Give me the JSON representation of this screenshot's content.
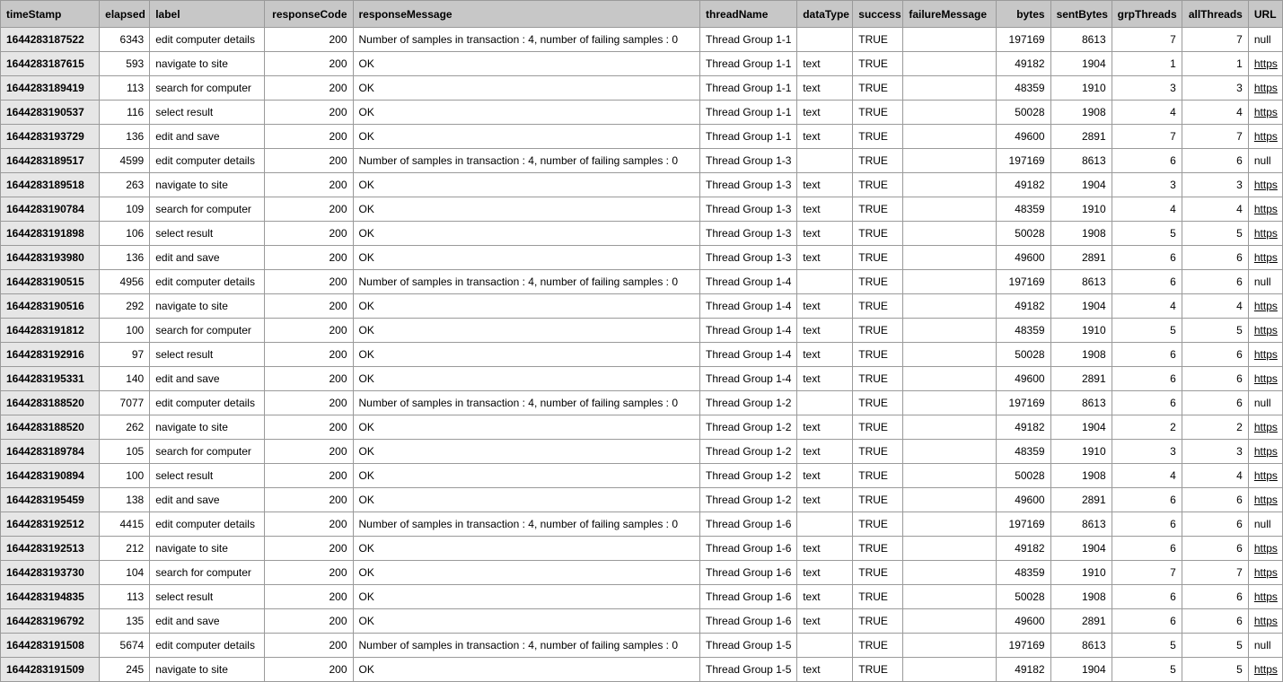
{
  "headers": [
    "timeStamp",
    "elapsed",
    "label",
    "responseCode",
    "responseMessage",
    "threadName",
    "dataType",
    "success",
    "failureMessage",
    "bytes",
    "sentBytes",
    "grpThreads",
    "allThreads",
    "URL"
  ],
  "rows": [
    {
      "timeStamp": "1644283187522",
      "elapsed": "6343",
      "label": "edit computer details",
      "responseCode": "200",
      "responseMessage": "Number of samples in transaction : 4, number of failing samples : 0",
      "threadName": "Thread Group 1-1",
      "dataType": "",
      "success": "TRUE",
      "failureMessage": "",
      "bytes": "197169",
      "sentBytes": "8613",
      "grpThreads": "7",
      "allThreads": "7",
      "URL": "null"
    },
    {
      "timeStamp": "1644283187615",
      "elapsed": "593",
      "label": "navigate to site",
      "responseCode": "200",
      "responseMessage": "OK",
      "threadName": "Thread Group 1-1",
      "dataType": "text",
      "success": "TRUE",
      "failureMessage": "",
      "bytes": "49182",
      "sentBytes": "1904",
      "grpThreads": "1",
      "allThreads": "1",
      "URL": "https"
    },
    {
      "timeStamp": "1644283189419",
      "elapsed": "113",
      "label": "search for computer",
      "responseCode": "200",
      "responseMessage": "OK",
      "threadName": "Thread Group 1-1",
      "dataType": "text",
      "success": "TRUE",
      "failureMessage": "",
      "bytes": "48359",
      "sentBytes": "1910",
      "grpThreads": "3",
      "allThreads": "3",
      "URL": "https"
    },
    {
      "timeStamp": "1644283190537",
      "elapsed": "116",
      "label": "select result",
      "responseCode": "200",
      "responseMessage": "OK",
      "threadName": "Thread Group 1-1",
      "dataType": "text",
      "success": "TRUE",
      "failureMessage": "",
      "bytes": "50028",
      "sentBytes": "1908",
      "grpThreads": "4",
      "allThreads": "4",
      "URL": "https"
    },
    {
      "timeStamp": "1644283193729",
      "elapsed": "136",
      "label": "edit and save",
      "responseCode": "200",
      "responseMessage": "OK",
      "threadName": "Thread Group 1-1",
      "dataType": "text",
      "success": "TRUE",
      "failureMessage": "",
      "bytes": "49600",
      "sentBytes": "2891",
      "grpThreads": "7",
      "allThreads": "7",
      "URL": "https"
    },
    {
      "timeStamp": "1644283189517",
      "elapsed": "4599",
      "label": "edit computer details",
      "responseCode": "200",
      "responseMessage": "Number of samples in transaction : 4, number of failing samples : 0",
      "threadName": "Thread Group 1-3",
      "dataType": "",
      "success": "TRUE",
      "failureMessage": "",
      "bytes": "197169",
      "sentBytes": "8613",
      "grpThreads": "6",
      "allThreads": "6",
      "URL": "null"
    },
    {
      "timeStamp": "1644283189518",
      "elapsed": "263",
      "label": "navigate to site",
      "responseCode": "200",
      "responseMessage": "OK",
      "threadName": "Thread Group 1-3",
      "dataType": "text",
      "success": "TRUE",
      "failureMessage": "",
      "bytes": "49182",
      "sentBytes": "1904",
      "grpThreads": "3",
      "allThreads": "3",
      "URL": "https"
    },
    {
      "timeStamp": "1644283190784",
      "elapsed": "109",
      "label": "search for computer",
      "responseCode": "200",
      "responseMessage": "OK",
      "threadName": "Thread Group 1-3",
      "dataType": "text",
      "success": "TRUE",
      "failureMessage": "",
      "bytes": "48359",
      "sentBytes": "1910",
      "grpThreads": "4",
      "allThreads": "4",
      "URL": "https"
    },
    {
      "timeStamp": "1644283191898",
      "elapsed": "106",
      "label": "select result",
      "responseCode": "200",
      "responseMessage": "OK",
      "threadName": "Thread Group 1-3",
      "dataType": "text",
      "success": "TRUE",
      "failureMessage": "",
      "bytes": "50028",
      "sentBytes": "1908",
      "grpThreads": "5",
      "allThreads": "5",
      "URL": "https"
    },
    {
      "timeStamp": "1644283193980",
      "elapsed": "136",
      "label": "edit and save",
      "responseCode": "200",
      "responseMessage": "OK",
      "threadName": "Thread Group 1-3",
      "dataType": "text",
      "success": "TRUE",
      "failureMessage": "",
      "bytes": "49600",
      "sentBytes": "2891",
      "grpThreads": "6",
      "allThreads": "6",
      "URL": "https"
    },
    {
      "timeStamp": "1644283190515",
      "elapsed": "4956",
      "label": "edit computer details",
      "responseCode": "200",
      "responseMessage": "Number of samples in transaction : 4, number of failing samples : 0",
      "threadName": "Thread Group 1-4",
      "dataType": "",
      "success": "TRUE",
      "failureMessage": "",
      "bytes": "197169",
      "sentBytes": "8613",
      "grpThreads": "6",
      "allThreads": "6",
      "URL": "null"
    },
    {
      "timeStamp": "1644283190516",
      "elapsed": "292",
      "label": "navigate to site",
      "responseCode": "200",
      "responseMessage": "OK",
      "threadName": "Thread Group 1-4",
      "dataType": "text",
      "success": "TRUE",
      "failureMessage": "",
      "bytes": "49182",
      "sentBytes": "1904",
      "grpThreads": "4",
      "allThreads": "4",
      "URL": "https"
    },
    {
      "timeStamp": "1644283191812",
      "elapsed": "100",
      "label": "search for computer",
      "responseCode": "200",
      "responseMessage": "OK",
      "threadName": "Thread Group 1-4",
      "dataType": "text",
      "success": "TRUE",
      "failureMessage": "",
      "bytes": "48359",
      "sentBytes": "1910",
      "grpThreads": "5",
      "allThreads": "5",
      "URL": "https"
    },
    {
      "timeStamp": "1644283192916",
      "elapsed": "97",
      "label": "select result",
      "responseCode": "200",
      "responseMessage": "OK",
      "threadName": "Thread Group 1-4",
      "dataType": "text",
      "success": "TRUE",
      "failureMessage": "",
      "bytes": "50028",
      "sentBytes": "1908",
      "grpThreads": "6",
      "allThreads": "6",
      "URL": "https"
    },
    {
      "timeStamp": "1644283195331",
      "elapsed": "140",
      "label": "edit and save",
      "responseCode": "200",
      "responseMessage": "OK",
      "threadName": "Thread Group 1-4",
      "dataType": "text",
      "success": "TRUE",
      "failureMessage": "",
      "bytes": "49600",
      "sentBytes": "2891",
      "grpThreads": "6",
      "allThreads": "6",
      "URL": "https"
    },
    {
      "timeStamp": "1644283188520",
      "elapsed": "7077",
      "label": "edit computer details",
      "responseCode": "200",
      "responseMessage": "Number of samples in transaction : 4, number of failing samples : 0",
      "threadName": "Thread Group 1-2",
      "dataType": "",
      "success": "TRUE",
      "failureMessage": "",
      "bytes": "197169",
      "sentBytes": "8613",
      "grpThreads": "6",
      "allThreads": "6",
      "URL": "null"
    },
    {
      "timeStamp": "1644283188520",
      "elapsed": "262",
      "label": "navigate to site",
      "responseCode": "200",
      "responseMessage": "OK",
      "threadName": "Thread Group 1-2",
      "dataType": "text",
      "success": "TRUE",
      "failureMessage": "",
      "bytes": "49182",
      "sentBytes": "1904",
      "grpThreads": "2",
      "allThreads": "2",
      "URL": "https"
    },
    {
      "timeStamp": "1644283189784",
      "elapsed": "105",
      "label": "search for computer",
      "responseCode": "200",
      "responseMessage": "OK",
      "threadName": "Thread Group 1-2",
      "dataType": "text",
      "success": "TRUE",
      "failureMessage": "",
      "bytes": "48359",
      "sentBytes": "1910",
      "grpThreads": "3",
      "allThreads": "3",
      "URL": "https"
    },
    {
      "timeStamp": "1644283190894",
      "elapsed": "100",
      "label": "select result",
      "responseCode": "200",
      "responseMessage": "OK",
      "threadName": "Thread Group 1-2",
      "dataType": "text",
      "success": "TRUE",
      "failureMessage": "",
      "bytes": "50028",
      "sentBytes": "1908",
      "grpThreads": "4",
      "allThreads": "4",
      "URL": "https"
    },
    {
      "timeStamp": "1644283195459",
      "elapsed": "138",
      "label": "edit and save",
      "responseCode": "200",
      "responseMessage": "OK",
      "threadName": "Thread Group 1-2",
      "dataType": "text",
      "success": "TRUE",
      "failureMessage": "",
      "bytes": "49600",
      "sentBytes": "2891",
      "grpThreads": "6",
      "allThreads": "6",
      "URL": "https"
    },
    {
      "timeStamp": "1644283192512",
      "elapsed": "4415",
      "label": "edit computer details",
      "responseCode": "200",
      "responseMessage": "Number of samples in transaction : 4, number of failing samples : 0",
      "threadName": "Thread Group 1-6",
      "dataType": "",
      "success": "TRUE",
      "failureMessage": "",
      "bytes": "197169",
      "sentBytes": "8613",
      "grpThreads": "6",
      "allThreads": "6",
      "URL": "null"
    },
    {
      "timeStamp": "1644283192513",
      "elapsed": "212",
      "label": "navigate to site",
      "responseCode": "200",
      "responseMessage": "OK",
      "threadName": "Thread Group 1-6",
      "dataType": "text",
      "success": "TRUE",
      "failureMessage": "",
      "bytes": "49182",
      "sentBytes": "1904",
      "grpThreads": "6",
      "allThreads": "6",
      "URL": "https"
    },
    {
      "timeStamp": "1644283193730",
      "elapsed": "104",
      "label": "search for computer",
      "responseCode": "200",
      "responseMessage": "OK",
      "threadName": "Thread Group 1-6",
      "dataType": "text",
      "success": "TRUE",
      "failureMessage": "",
      "bytes": "48359",
      "sentBytes": "1910",
      "grpThreads": "7",
      "allThreads": "7",
      "URL": "https"
    },
    {
      "timeStamp": "1644283194835",
      "elapsed": "113",
      "label": "select result",
      "responseCode": "200",
      "responseMessage": "OK",
      "threadName": "Thread Group 1-6",
      "dataType": "text",
      "success": "TRUE",
      "failureMessage": "",
      "bytes": "50028",
      "sentBytes": "1908",
      "grpThreads": "6",
      "allThreads": "6",
      "URL": "https"
    },
    {
      "timeStamp": "1644283196792",
      "elapsed": "135",
      "label": "edit and save",
      "responseCode": "200",
      "responseMessage": "OK",
      "threadName": "Thread Group 1-6",
      "dataType": "text",
      "success": "TRUE",
      "failureMessage": "",
      "bytes": "49600",
      "sentBytes": "2891",
      "grpThreads": "6",
      "allThreads": "6",
      "URL": "https"
    },
    {
      "timeStamp": "1644283191508",
      "elapsed": "5674",
      "label": "edit computer details",
      "responseCode": "200",
      "responseMessage": "Number of samples in transaction : 4, number of failing samples : 0",
      "threadName": "Thread Group 1-5",
      "dataType": "",
      "success": "TRUE",
      "failureMessage": "",
      "bytes": "197169",
      "sentBytes": "8613",
      "grpThreads": "5",
      "allThreads": "5",
      "URL": "null"
    },
    {
      "timeStamp": "1644283191509",
      "elapsed": "245",
      "label": "navigate to site",
      "responseCode": "200",
      "responseMessage": "OK",
      "threadName": "Thread Group 1-5",
      "dataType": "text",
      "success": "TRUE",
      "failureMessage": "",
      "bytes": "49182",
      "sentBytes": "1904",
      "grpThreads": "5",
      "allThreads": "5",
      "URL": "https"
    }
  ]
}
